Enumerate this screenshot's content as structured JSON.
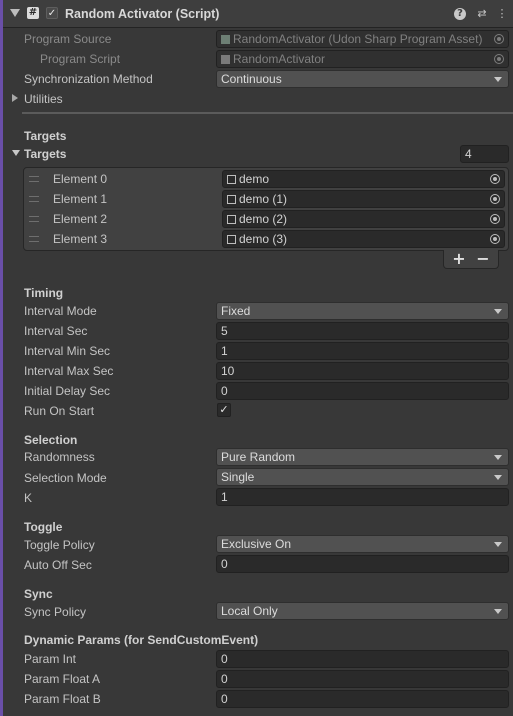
{
  "header": {
    "title": "Random Activator (Script)",
    "enabled": true,
    "icons": [
      "script-icon",
      "help-icon",
      "presets-icon",
      "context-menu-icon"
    ]
  },
  "program": {
    "source_label": "Program Source",
    "source_value": "RandomActivator (Udon Sharp Program Asset)",
    "script_label": "Program Script",
    "script_value": "RandomActivator"
  },
  "sync_method": {
    "label": "Synchronization Method",
    "value": "Continuous"
  },
  "utilities": {
    "label": "Utilities"
  },
  "targets": {
    "section_label": "Targets",
    "list_label": "Targets",
    "count": "4",
    "elements": [
      {
        "label": "Element 0",
        "value": "demo"
      },
      {
        "label": "Element 1",
        "value": "demo (1)"
      },
      {
        "label": "Element 2",
        "value": "demo (2)"
      },
      {
        "label": "Element 3",
        "value": "demo (3)"
      }
    ],
    "add_label": "+",
    "remove_label": "−"
  },
  "timing": {
    "section_label": "Timing",
    "interval_mode_label": "Interval Mode",
    "interval_mode": "Fixed",
    "interval_sec_label": "Interval Sec",
    "interval_sec": "5",
    "interval_min_label": "Interval Min Sec",
    "interval_min": "1",
    "interval_max_label": "Interval Max Sec",
    "interval_max": "10",
    "initial_delay_label": "Initial Delay Sec",
    "initial_delay": "0",
    "run_on_start_label": "Run On Start",
    "run_on_start": true
  },
  "selection": {
    "section_label": "Selection",
    "randomness_label": "Randomness",
    "randomness": "Pure Random",
    "mode_label": "Selection Mode",
    "mode": "Single",
    "k_label": "K",
    "k": "1"
  },
  "toggle": {
    "section_label": "Toggle",
    "policy_label": "Toggle Policy",
    "policy": "Exclusive On",
    "auto_off_label": "Auto Off Sec",
    "auto_off": "0"
  },
  "sync": {
    "section_label": "Sync",
    "policy_label": "Sync Policy",
    "policy": "Local Only"
  },
  "dynamic": {
    "section_label": "Dynamic Params (for SendCustomEvent)",
    "param_int_label": "Param Int",
    "param_int": "0",
    "param_float_a_label": "Param Float A",
    "param_float_a": "0",
    "param_float_b_label": "Param Float B",
    "param_float_b": "0"
  },
  "colors": {
    "accent": "#6a4fa8",
    "background": "#383838",
    "field": "#2a2a2a",
    "dropdown": "#515151"
  }
}
